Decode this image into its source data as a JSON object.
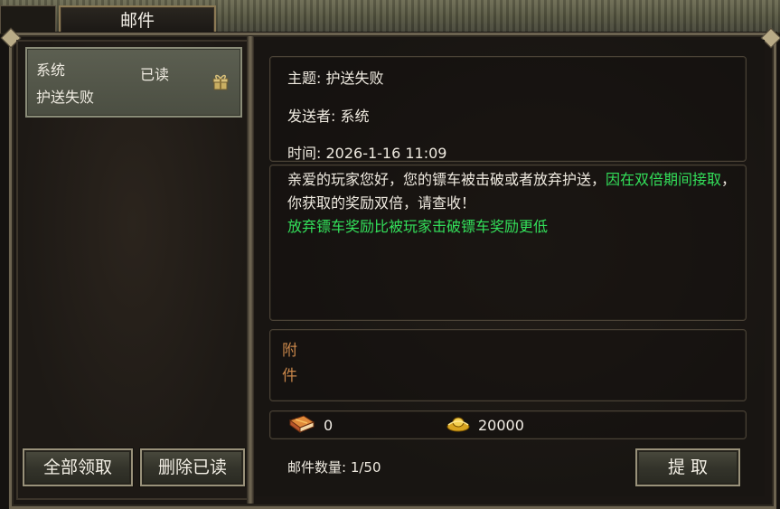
{
  "window": {
    "tab_title": "邮件"
  },
  "mail_list": {
    "items": [
      {
        "sender": "系统",
        "status": "已读",
        "subject": "护送失败",
        "icon": "gift-icon"
      }
    ],
    "claim_all_label": "全部领取",
    "delete_read_label": "删除已读"
  },
  "mail_detail": {
    "subject_line": "主题: 护送失败",
    "sender_line": "发送者: 系统",
    "time_line": "时间: 2026-1-16 11:09",
    "body": {
      "part1": "亲爱的玩家您好，您的镖车被击破或者放弃护送，",
      "part2_highlight": "因在双倍期间接取",
      "part3": "，你获取的奖励双倍，请查收！",
      "line2_highlight": "放弃镖车奖励比被玩家击破镖车奖励更低"
    },
    "attachment_label": "附件",
    "resources": [
      {
        "icon": "book-icon",
        "value": "0"
      },
      {
        "icon": "gold-ingot-icon",
        "value": "20000"
      }
    ],
    "mail_count": "邮件数量:  1/50",
    "claim_label": "提 取"
  },
  "colors": {
    "highlight_green": "#33e05a",
    "attachment_label": "#c8864a",
    "frame_gold": "#6c6350"
  }
}
